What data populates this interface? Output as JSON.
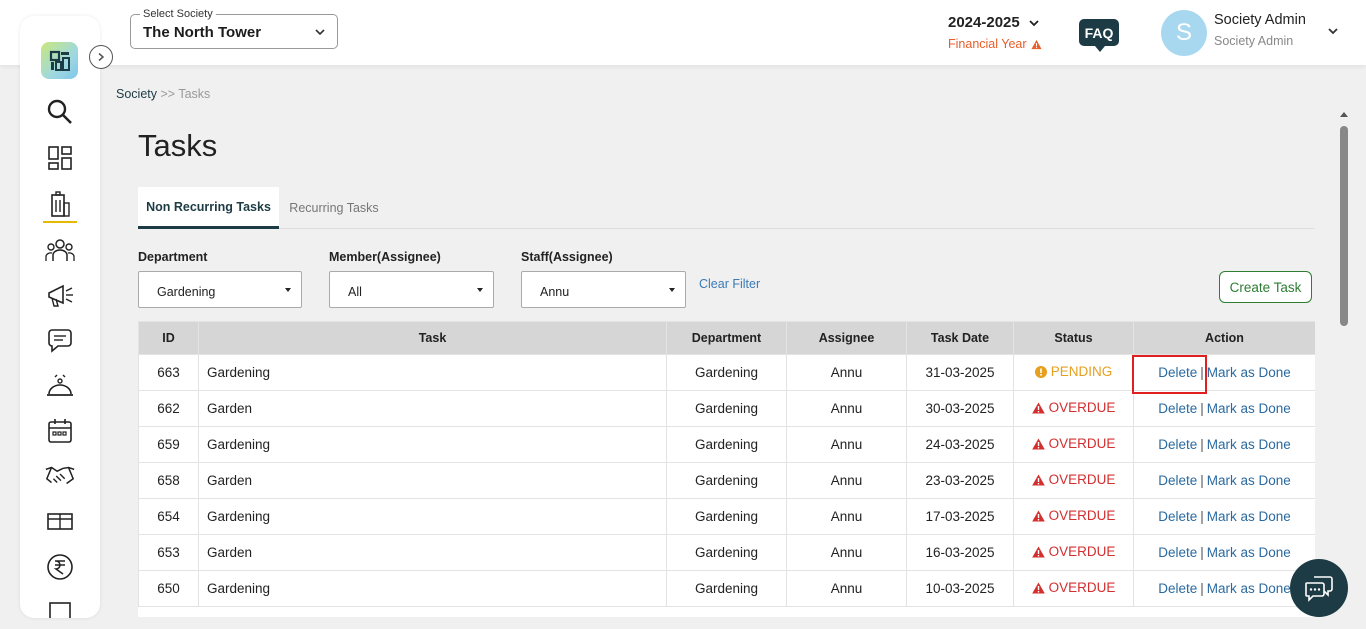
{
  "header": {
    "society_label": "Select Society",
    "society_value": "The North Tower",
    "financial_year": "2024-2025",
    "financial_year_label": "Financial Year",
    "faq": "FAQ",
    "avatar_initial": "S",
    "user_name": "Society Admin",
    "user_role": "Society Admin"
  },
  "breadcrumb": {
    "root": "Society",
    "separator": ">>",
    "current": "Tasks"
  },
  "page_title": "Tasks",
  "tabs": [
    {
      "label": "Non Recurring Tasks",
      "active": true
    },
    {
      "label": "Recurring Tasks",
      "active": false
    }
  ],
  "filters": {
    "department": {
      "label": "Department",
      "value": "Gardening"
    },
    "member": {
      "label": "Member(Assignee)",
      "value": "All"
    },
    "staff": {
      "label": "Staff(Assignee)",
      "value": "Annu"
    },
    "clear_label": "Clear Filter"
  },
  "create_task_label": "Create Task",
  "table": {
    "columns": [
      "ID",
      "Task",
      "Department",
      "Assignee",
      "Task Date",
      "Status",
      "Action"
    ],
    "rows": [
      {
        "id": "663",
        "task": "Gardening",
        "department": "Gardening",
        "assignee": "Annu",
        "date": "31-03-2025",
        "status": "PENDING"
      },
      {
        "id": "662",
        "task": "Garden",
        "department": "Gardening",
        "assignee": "Annu",
        "date": "30-03-2025",
        "status": "OVERDUE"
      },
      {
        "id": "659",
        "task": "Gardening",
        "department": "Gardening",
        "assignee": "Annu",
        "date": "24-03-2025",
        "status": "OVERDUE"
      },
      {
        "id": "658",
        "task": "Garden",
        "department": "Gardening",
        "assignee": "Annu",
        "date": "23-03-2025",
        "status": "OVERDUE"
      },
      {
        "id": "654",
        "task": "Gardening",
        "department": "Gardening",
        "assignee": "Annu",
        "date": "17-03-2025",
        "status": "OVERDUE"
      },
      {
        "id": "653",
        "task": "Garden",
        "department": "Gardening",
        "assignee": "Annu",
        "date": "16-03-2025",
        "status": "OVERDUE"
      },
      {
        "id": "650",
        "task": "Gardening",
        "department": "Gardening",
        "assignee": "Annu",
        "date": "10-03-2025",
        "status": "OVERDUE"
      }
    ],
    "action_delete": "Delete",
    "action_separator": "|",
    "action_done": "Mark as Done"
  },
  "sidebar_icons": [
    "search-icon",
    "dashboard-icon",
    "building-icon",
    "members-icon",
    "announcement-icon",
    "chat-icon",
    "service-icon",
    "calendar-icon",
    "handshake-icon",
    "amenity-icon",
    "rupee-icon",
    "more-icon"
  ],
  "colors": {
    "accent": "#1d3b45",
    "pending": "#e6a020",
    "overdue": "#d32f2f",
    "link": "#2a6aa0",
    "create": "#2e7d32",
    "highlight": "#e02020"
  }
}
